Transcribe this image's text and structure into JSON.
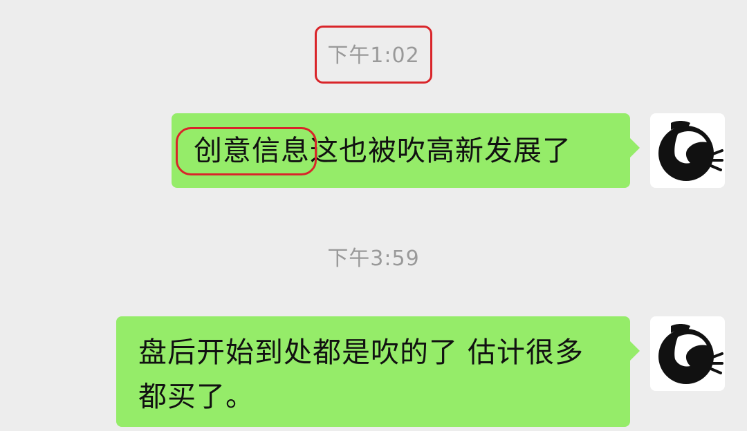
{
  "chat": {
    "messages": [
      {
        "type": "timestamp",
        "text": "下午1:02"
      },
      {
        "type": "outgoing",
        "highlight": "创意信息",
        "rest": "这也被吹高新发展了",
        "avatar": "horse-logo-avatar"
      },
      {
        "type": "timestamp",
        "text": "下午3:59"
      },
      {
        "type": "outgoing",
        "text": "盘后开始到处都是吹的了 估计很多都买了。",
        "avatar": "horse-logo-avatar"
      }
    ]
  },
  "colors": {
    "background": "#ededed",
    "bubble": "#95ec69",
    "highlight_box": "#d9252a",
    "timestamp_text": "#999999"
  }
}
